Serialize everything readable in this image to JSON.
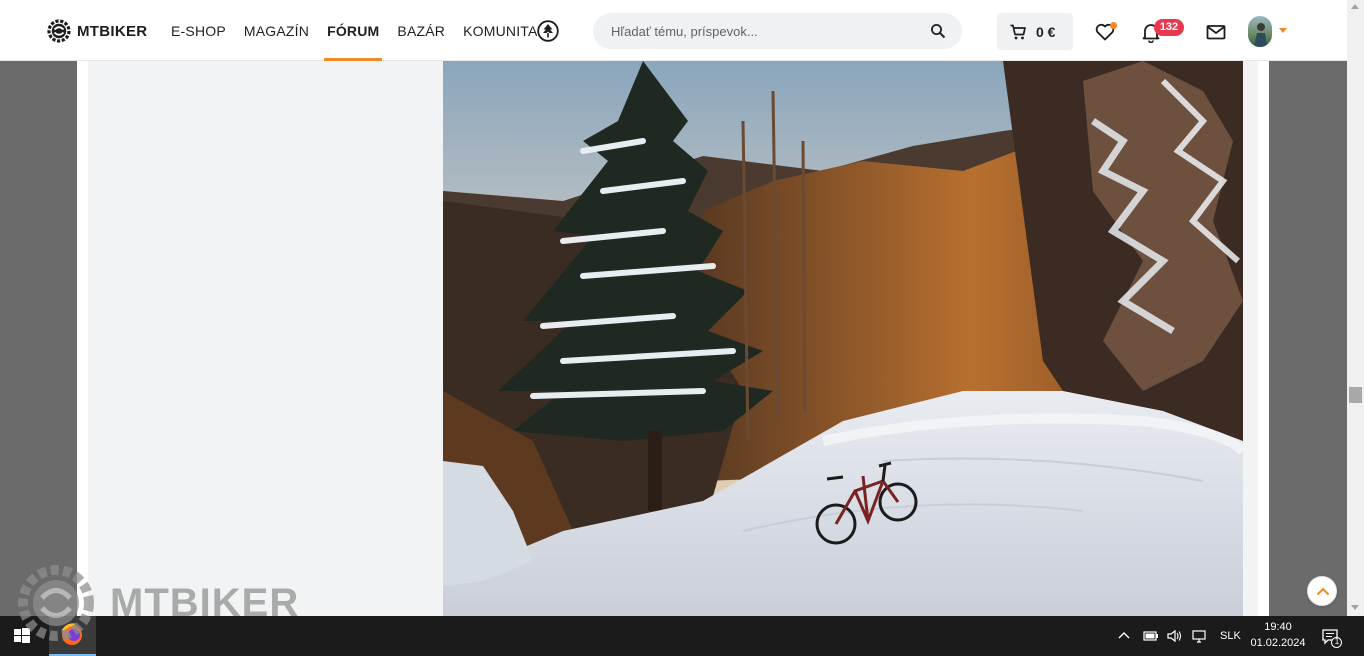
{
  "header": {
    "logo_text": "MTBIKER",
    "nav": [
      {
        "label": "E-SHOP"
      },
      {
        "label": "MAGAZÍN"
      },
      {
        "label": "FÓRUM"
      },
      {
        "label": "BAZÁR"
      },
      {
        "label": "KOMUNITA"
      }
    ],
    "active_nav": "FÓRUM",
    "search_placeholder": "Hľadať tému, príspevok...",
    "cart_amount": "0 €",
    "notifications_count": "132",
    "accent_color": "#f08a24",
    "badge_color": "#e8384f"
  },
  "watermark": {
    "text": "MTBIKER"
  },
  "taskbar": {
    "language": "SLK",
    "time": "19:40",
    "date": "01.02.2024",
    "notification_count": "1"
  }
}
